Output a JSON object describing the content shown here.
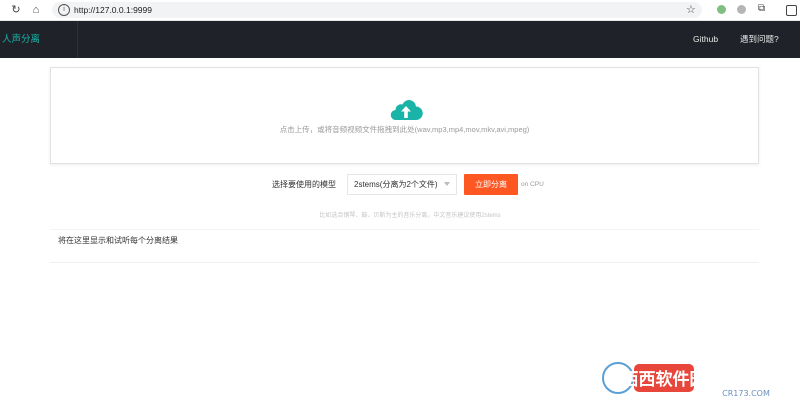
{
  "browser": {
    "url": "http://127.0.0.1:9999"
  },
  "navbar": {
    "brand": "人声分离",
    "links": [
      "Github",
      "遇到问题?"
    ]
  },
  "upload": {
    "hint": "点击上传，或将音频视频文件拖拽到此处(wav,mp3,mp4,mov,mkv,avi,mpeg)"
  },
  "model": {
    "label": "选择要使用的模型",
    "selected": "2stems(分离为2个文件)",
    "button": "立即分离",
    "device": "on CPU",
    "tip": "比如选合钢琴、鼓、贝斯为主的音乐分离，中文音乐建议使用2stems"
  },
  "results": {
    "placeholder": "将在这里显示和试听每个分离结果"
  },
  "watermark": {
    "text": "西西软件园",
    "sub": "CR173.COM"
  },
  "colors": {
    "navbar": "#1f2329",
    "brand": "#19b3a7",
    "primary_button": "#ff5722",
    "cloud": "#19b3a7"
  }
}
